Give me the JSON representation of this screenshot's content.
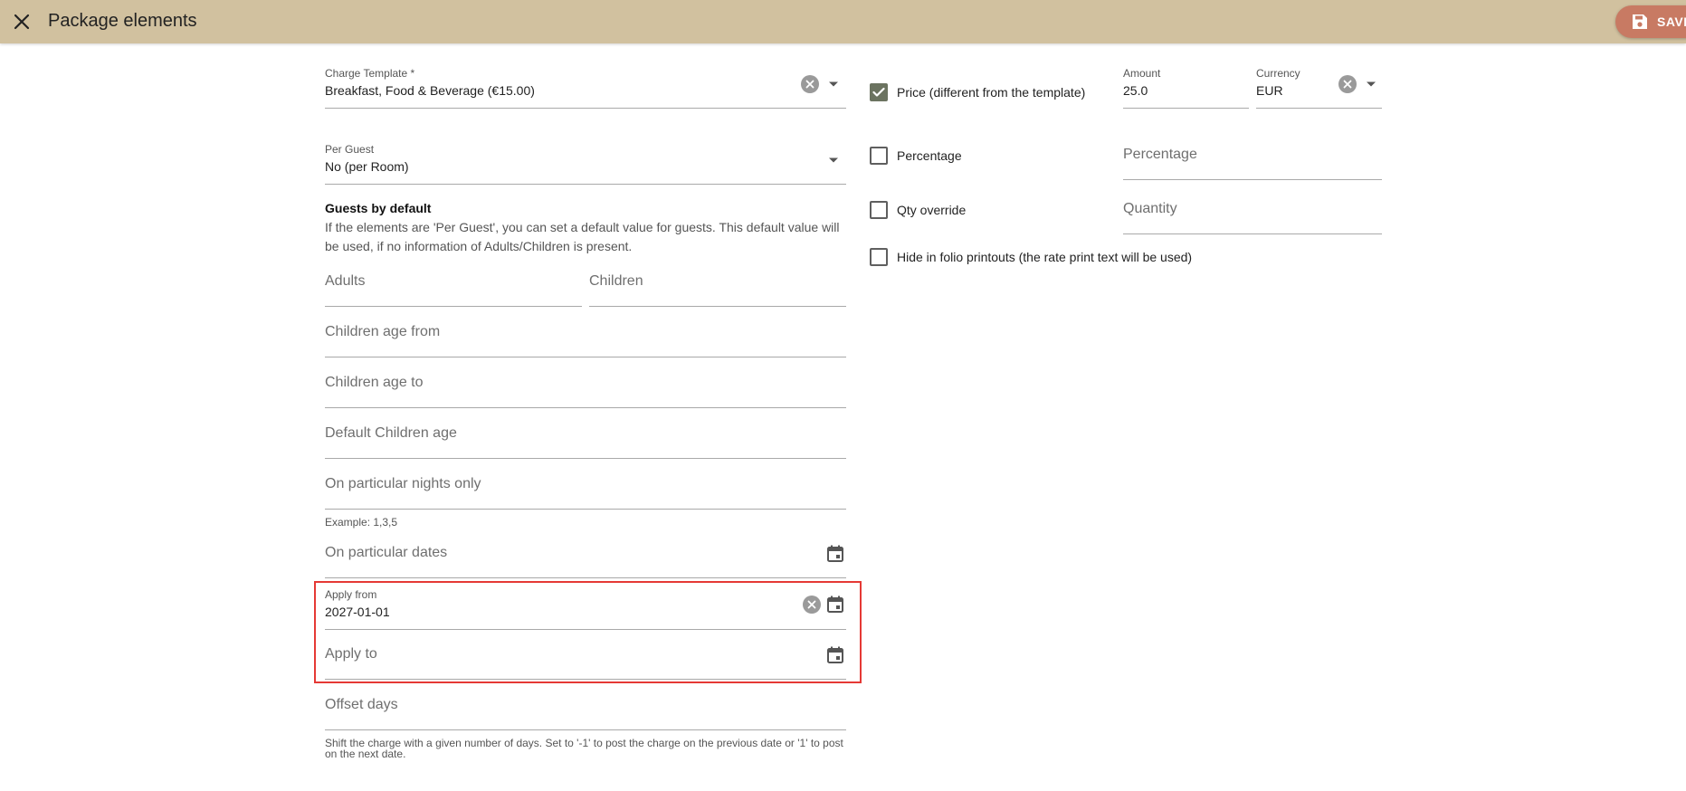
{
  "header": {
    "title": "Package elements",
    "save_label": "SAVE"
  },
  "left": {
    "charge_template": {
      "label": "Charge Template *",
      "value": "Breakfast, Food & Beverage (€15.00)"
    },
    "per_guest": {
      "label": "Per Guest",
      "value": "No (per Room)"
    },
    "guests_default": {
      "title": "Guests by default",
      "desc_line1": "If the elements are 'Per Guest', you can set a default value for guests. This default value will",
      "desc_line2": "be used, if no information of Adults/Children is present."
    },
    "adults_placeholder": "Adults",
    "children_placeholder": "Children",
    "children_age_from_placeholder": "Children age from",
    "children_age_to_placeholder": "Children age to",
    "default_children_age_placeholder": "Default Children age",
    "particular_nights": {
      "placeholder": "On particular nights only",
      "hint": "Example: 1,3,5"
    },
    "particular_dates_placeholder": "On particular dates",
    "apply_from": {
      "label": "Apply from",
      "value": "2027-01-01"
    },
    "apply_to_placeholder": "Apply to",
    "offset_days": {
      "placeholder": "Offset days",
      "hint_line1": "Shift the charge with a given number of days. Set to '-1' to post the charge on the previous date or '1' to post",
      "hint_line2": "on the next date."
    }
  },
  "right": {
    "price_checkbox": {
      "label": "Price (different from the template)",
      "checked": true
    },
    "amount": {
      "label": "Amount",
      "value": "25.0"
    },
    "currency": {
      "label": "Currency",
      "value": "EUR"
    },
    "percentage_checkbox": {
      "label": "Percentage",
      "checked": false
    },
    "percentage_placeholder": "Percentage",
    "qty_checkbox": {
      "label": "Qty override",
      "checked": false
    },
    "quantity_placeholder": "Quantity",
    "hide_folio_checkbox": {
      "label": "Hide in folio printouts (the rate print text will be used)",
      "checked": false
    }
  },
  "colors": {
    "topbar": "#d1c19f",
    "save_button": "#c87a63",
    "checkbox_checked": "#6b7360",
    "highlight": "#e53935"
  }
}
